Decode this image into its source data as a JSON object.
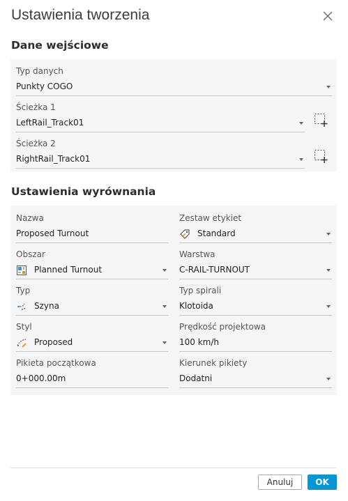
{
  "dialog": {
    "title": "Ustawienia tworzenia",
    "cancel_label": "Anuluj",
    "ok_label": "OK",
    "accent_color": "#0696d7"
  },
  "input_section": {
    "heading": "Dane wejściowe",
    "data_type": {
      "label": "Typ danych",
      "value": "Punkty COGO"
    },
    "path1": {
      "label": "Ścieżka 1",
      "value": "LeftRail_Track01",
      "pick_icon": "select-region-add-icon"
    },
    "path2": {
      "label": "Ścieżka 2",
      "value": "RightRail_Track01",
      "pick_icon": "select-region-add-icon"
    }
  },
  "alignment_section": {
    "heading": "Ustawienia wyrównania",
    "name": {
      "label": "Nazwa",
      "value": "Proposed Turnout"
    },
    "label_set": {
      "label": "Zestaw etykiet",
      "value": "Standard",
      "icon": "label-tag-icon"
    },
    "site": {
      "label": "Obszar",
      "value": "Planned Turnout",
      "icon": "site-icon"
    },
    "layer": {
      "label": "Warstwa",
      "value": "C-RAIL-TURNOUT"
    },
    "type": {
      "label": "Typ",
      "value": "Szyna",
      "icon": "alignment-type-icon"
    },
    "spiral_type": {
      "label": "Typ spirali",
      "value": "Klotoida"
    },
    "style": {
      "label": "Styl",
      "value": "Proposed",
      "icon": "style-icon"
    },
    "design_speed": {
      "label": "Prędkość projektowa",
      "value": "100 km/h"
    },
    "start_station": {
      "label": "Pikieta początkowa",
      "value": "0+000.00m"
    },
    "station_direction": {
      "label": "Kierunek pikiety",
      "value": "Dodatni"
    }
  }
}
